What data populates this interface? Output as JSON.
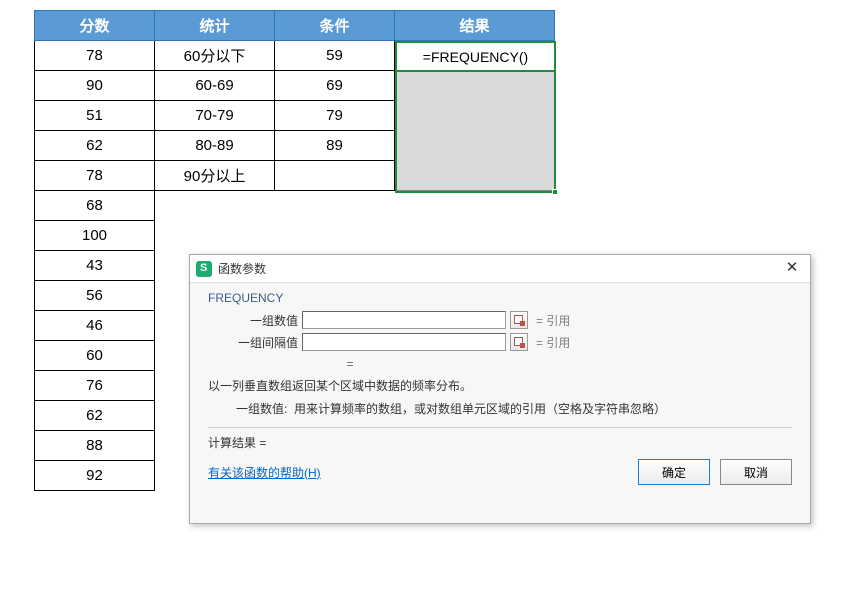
{
  "table": {
    "headers": [
      "分数",
      "统计",
      "条件",
      "结果"
    ],
    "scores": [
      78,
      90,
      51,
      62,
      78,
      68,
      100,
      43,
      56,
      46,
      60,
      76,
      62,
      88,
      92
    ],
    "stats": [
      "60分以下",
      "60-69",
      "70-79",
      "80-89",
      "90分以上"
    ],
    "conds": [
      59,
      69,
      79,
      89
    ],
    "active_formula": "=FREQUENCY()"
  },
  "dialog": {
    "title": "函数参数",
    "func": "FREQUENCY",
    "param1_label": "一组数值",
    "param2_label": "一组间隔值",
    "eq": "=",
    "preview1": "= 引用",
    "preview2": "= 引用",
    "center_eq": "=",
    "desc1": "以一列垂直数组返回某个区域中数据的频率分布。",
    "desc2_lbl": "一组数值:",
    "desc2_txt": "用来计算频率的数组，或对数组单元区域的引用（空格及字符串忽略）",
    "result_label": "计算结果 =",
    "help": "有关该函数的帮助(H)",
    "ok": "确定",
    "cancel": "取消"
  }
}
